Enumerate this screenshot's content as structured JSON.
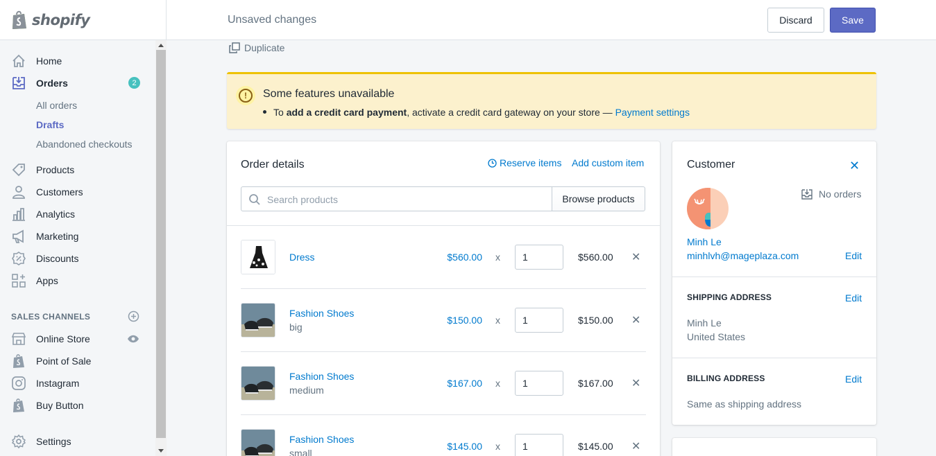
{
  "app": {
    "brand": "shopify"
  },
  "sidebar": {
    "items": [
      {
        "label": "Home",
        "icon": "home-icon"
      },
      {
        "label": "Orders",
        "icon": "orders-icon",
        "badge": "2"
      },
      {
        "label": "Products",
        "icon": "tag-icon"
      },
      {
        "label": "Customers",
        "icon": "person-icon"
      },
      {
        "label": "Analytics",
        "icon": "bar-chart-icon"
      },
      {
        "label": "Marketing",
        "icon": "megaphone-icon"
      },
      {
        "label": "Discounts",
        "icon": "discount-icon"
      },
      {
        "label": "Apps",
        "icon": "apps-icon"
      }
    ],
    "order_subitems": [
      "All orders",
      "Drafts",
      "Abandoned checkouts"
    ],
    "sales_channels_heading": "SALES CHANNELS",
    "channels": [
      {
        "label": "Online Store",
        "icon": "store-icon"
      },
      {
        "label": "Point of Sale",
        "icon": "shopify-bag-icon"
      },
      {
        "label": "Instagram",
        "icon": "instagram-icon"
      },
      {
        "label": "Buy Button",
        "icon": "shopify-bag-icon"
      }
    ],
    "settings": "Settings"
  },
  "topbar": {
    "title": "Unsaved changes",
    "discard": "Discard",
    "save": "Save"
  },
  "actions": {
    "duplicate": "Duplicate"
  },
  "banner": {
    "title": "Some features unavailable",
    "prefix": "To ",
    "bold": "add a credit card payment",
    "middle": ", activate a credit card gateway on your store — ",
    "link": "Payment settings"
  },
  "order": {
    "title": "Order details",
    "reserve": "Reserve items",
    "add_custom": "Add custom item",
    "search_placeholder": "Search products",
    "browse": "Browse products",
    "multiply": "x",
    "lines": [
      {
        "name": "Dress",
        "variant": "",
        "price": "$560.00",
        "qty": "1",
        "total": "$560.00"
      },
      {
        "name": "Fashion Shoes",
        "variant": "big",
        "price": "$150.00",
        "qty": "1",
        "total": "$150.00"
      },
      {
        "name": "Fashion Shoes",
        "variant": "medium",
        "price": "$167.00",
        "qty": "1",
        "total": "$167.00"
      },
      {
        "name": "Fashion Shoes",
        "variant": "small",
        "price": "$145.00",
        "qty": "1",
        "total": "$145.00"
      }
    ]
  },
  "customer": {
    "title": "Customer",
    "orders": "No orders",
    "name": "Minh Le",
    "email": "minhlvh@mageplaza.com",
    "edit": "Edit",
    "shipping_heading": "SHIPPING ADDRESS",
    "shipping_name": "Minh Le",
    "shipping_country": "United States",
    "billing_heading": "BILLING ADDRESS",
    "billing_text": "Same as shipping address"
  },
  "colors": {
    "primary": "#5c6ac4",
    "link": "#007ace",
    "badge": "#47c1bf",
    "warning": "#eec200"
  }
}
